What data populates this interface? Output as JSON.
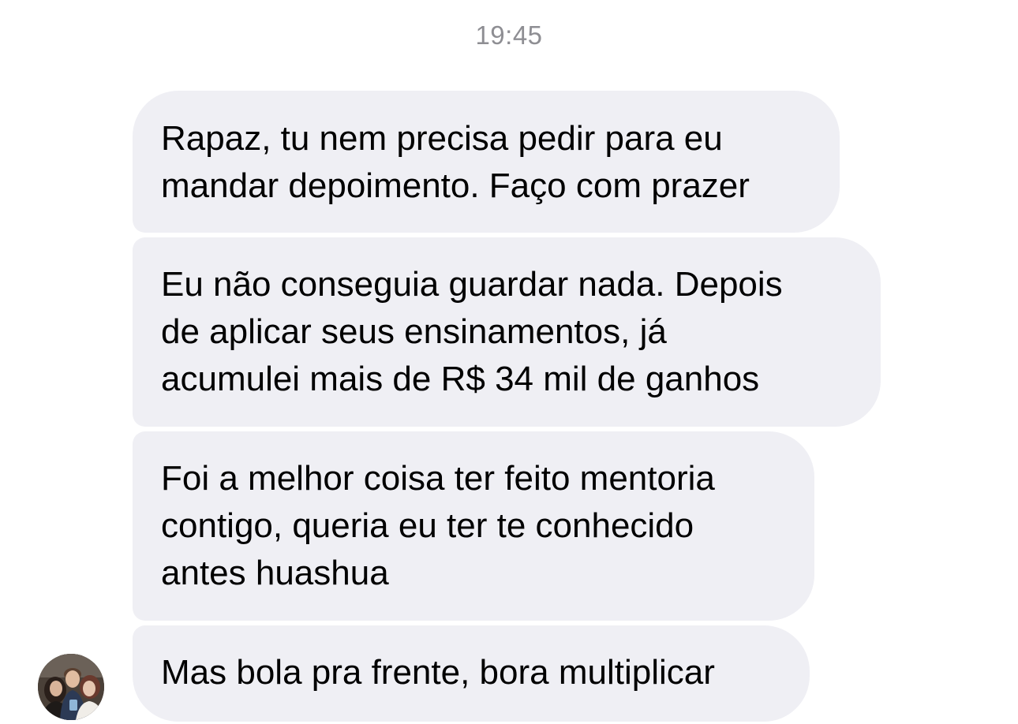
{
  "chat": {
    "timestamp": "19:45",
    "messages": [
      {
        "text": "Rapaz, tu nem precisa pedir para eu\nmandar depoimento. Faço com prazer"
      },
      {
        "text": "Eu não conseguia guardar nada. Depois\nde aplicar seus ensinamentos, já\nacumulei mais de R$ 34 mil de ganhos"
      },
      {
        "text": "Foi a melhor coisa ter feito mentoria\ncontigo, queria eu ter te conhecido\nantes huashua"
      },
      {
        "text": "Mas bola pra frente, bora multiplicar"
      }
    ],
    "bubble_color": "#efeff4",
    "timestamp_color": "#8e8e93",
    "sender_avatar": "group-photo-avatar"
  }
}
